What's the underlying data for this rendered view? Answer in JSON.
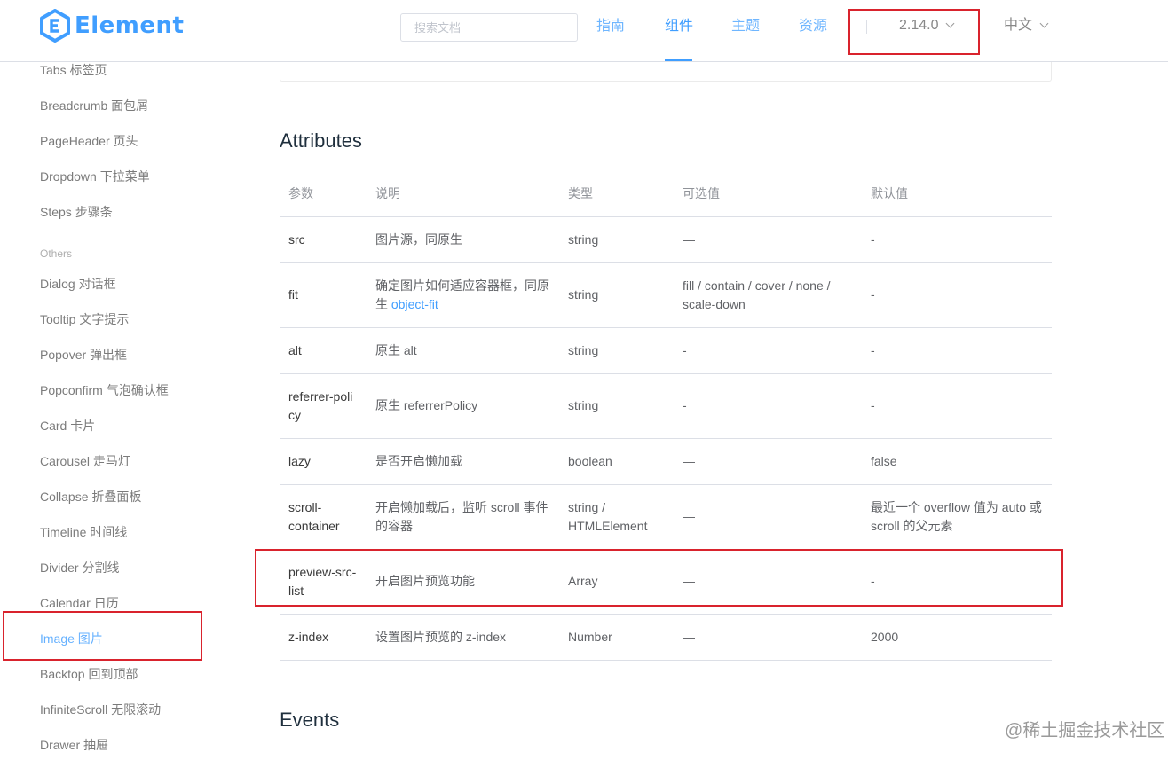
{
  "header": {
    "logo_text": "Element",
    "search_placeholder": "搜索文档",
    "nav": [
      "指南",
      "组件",
      "主题",
      "资源"
    ],
    "version": "2.14.0",
    "language": "中文"
  },
  "sidebar": {
    "items_top": [
      "Tabs 标签页",
      "Breadcrumb 面包屑",
      "PageHeader 页头",
      "Dropdown 下拉菜单",
      "Steps 步骤条"
    ],
    "group_label": "Others",
    "items_others": [
      "Dialog 对话框",
      "Tooltip 文字提示",
      "Popover 弹出框",
      "Popconfirm 气泡确认框",
      "Card 卡片",
      "Carousel 走马灯",
      "Collapse 折叠面板",
      "Timeline 时间线",
      "Divider 分割线",
      "Calendar 日历",
      "Image 图片",
      "Backtop 回到顶部",
      "InfiniteScroll 无限滚动",
      "Drawer 抽屉"
    ],
    "active_item": "Image 图片"
  },
  "main": {
    "attributes_title": "Attributes",
    "events_title": "Events",
    "table": {
      "headers": [
        "参数",
        "说明",
        "类型",
        "可选值",
        "默认值"
      ],
      "rows": [
        {
          "param": "src",
          "desc": "图片源，同原生",
          "type": "string",
          "options": "—",
          "default": "-"
        },
        {
          "param": "fit",
          "desc": "确定图片如何适应容器框，同原生",
          "desc_link": "object-fit",
          "type": "string",
          "options": "fill / contain / cover / none / scale-down",
          "default": "-"
        },
        {
          "param": "alt",
          "desc": "原生 alt",
          "type": "string",
          "options": "-",
          "default": "-"
        },
        {
          "param": "referrer-policy",
          "desc": "原生 referrerPolicy",
          "type": "string",
          "options": "-",
          "default": "-"
        },
        {
          "param": "lazy",
          "desc": "是否开启懒加载",
          "type": "boolean",
          "options": "—",
          "default": "false"
        },
        {
          "param": "scroll-container",
          "desc": "开启懒加载后，监听 scroll 事件的容器",
          "type": "string / HTMLElement",
          "options": "—",
          "default": "最近一个 overflow 值为 auto 或 scroll 的父元素"
        },
        {
          "param": "preview-src-list",
          "desc": "开启图片预览功能",
          "type": "Array",
          "options": "—",
          "default": "-"
        },
        {
          "param": "z-index",
          "desc": "设置图片预览的 z-index",
          "type": "Number",
          "options": "—",
          "default": "2000"
        }
      ]
    }
  },
  "watermark": "@稀土掘金技术社区",
  "colors": {
    "brand": "#409eff",
    "highlight_box": "#d9232d"
  }
}
